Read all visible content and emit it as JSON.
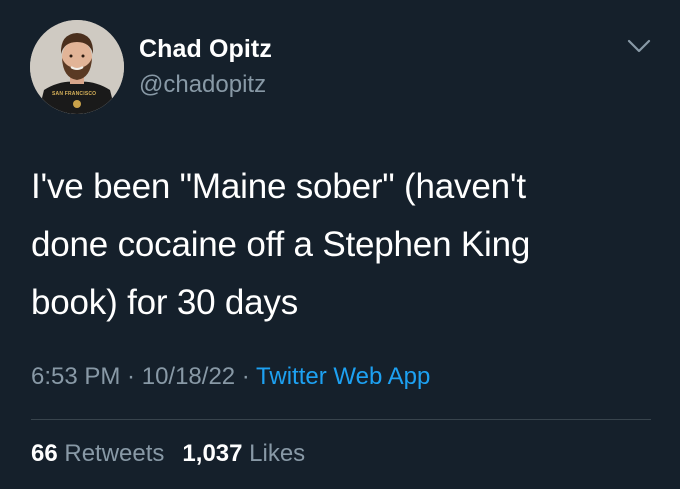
{
  "author": {
    "display_name": "Chad Opitz",
    "handle": "@chadopitz",
    "avatar_shirt_text": "SAN FRANCISCO"
  },
  "tweet": {
    "lines": [
      "I've been \"Maine sober\" (haven't",
      "done cocaine off a Stephen King",
      "book) for 30 days"
    ]
  },
  "meta": {
    "time": "6:53 PM",
    "sep1": " · ",
    "date": "10/18/22",
    "sep2": " · ",
    "source": "Twitter Web App"
  },
  "stats": {
    "retweets_count": "66",
    "retweets_label": "Retweets",
    "likes_count": "1,037",
    "likes_label": "Likes"
  },
  "icons": {
    "menu": "chevron-down-icon"
  },
  "colors": {
    "background": "#15202b",
    "primary_text": "#ffffff",
    "secondary_text": "#8899a6",
    "link": "#1da1f2",
    "divider": "#38444d"
  }
}
